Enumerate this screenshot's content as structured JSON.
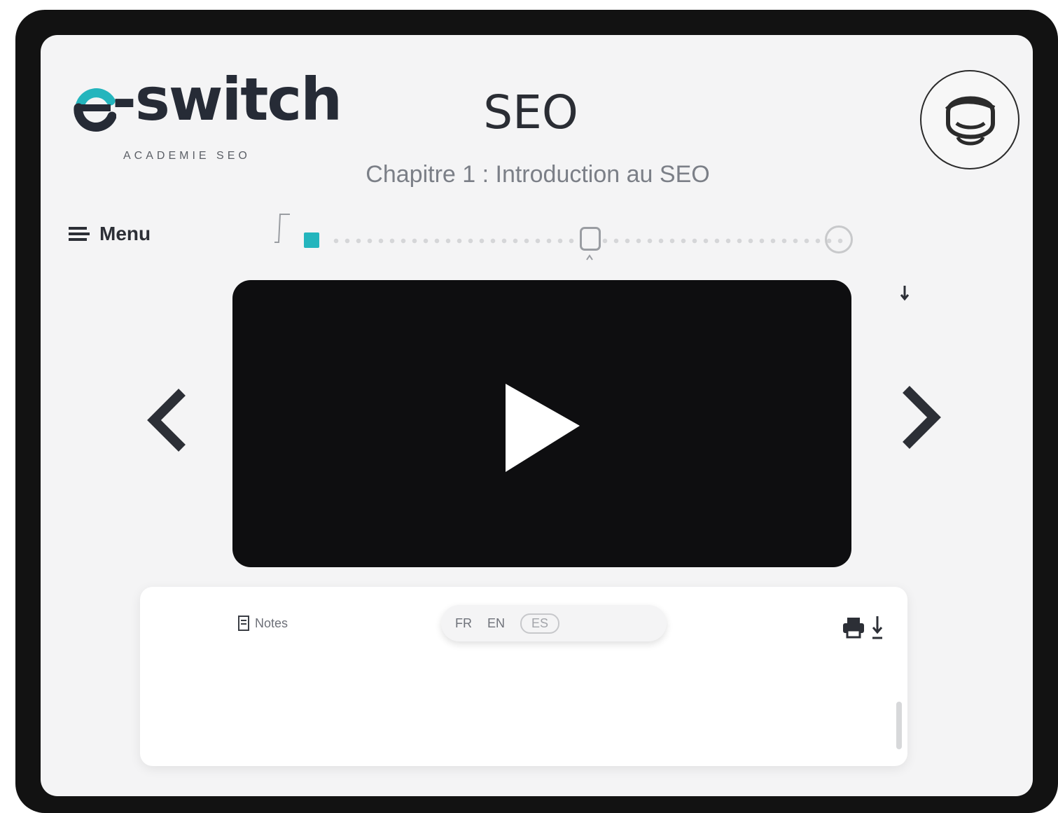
{
  "brand": {
    "name": "-switch",
    "tagline": "ACADEMIE SEO",
    "accent_color": "#24b5bd"
  },
  "header": {
    "title": "SEO",
    "chapter": "Chapitre 1 : Introduction au SEO"
  },
  "menu": {
    "label": "Menu",
    "icon": "hamburger-icon"
  },
  "progress": {
    "percent": 4,
    "handle_percent": 48
  },
  "video": {
    "play_icon": "play-icon"
  },
  "notes": {
    "tab_label": "Notes",
    "languages": [
      "FR",
      "EN",
      "ES"
    ],
    "selected_language": "ES",
    "print_icon": "print-icon",
    "download_icon": "download-icon"
  },
  "icons": {
    "prev": "chevron-left-icon",
    "next": "chevron-right-icon",
    "avatar": "avatar-icon"
  }
}
